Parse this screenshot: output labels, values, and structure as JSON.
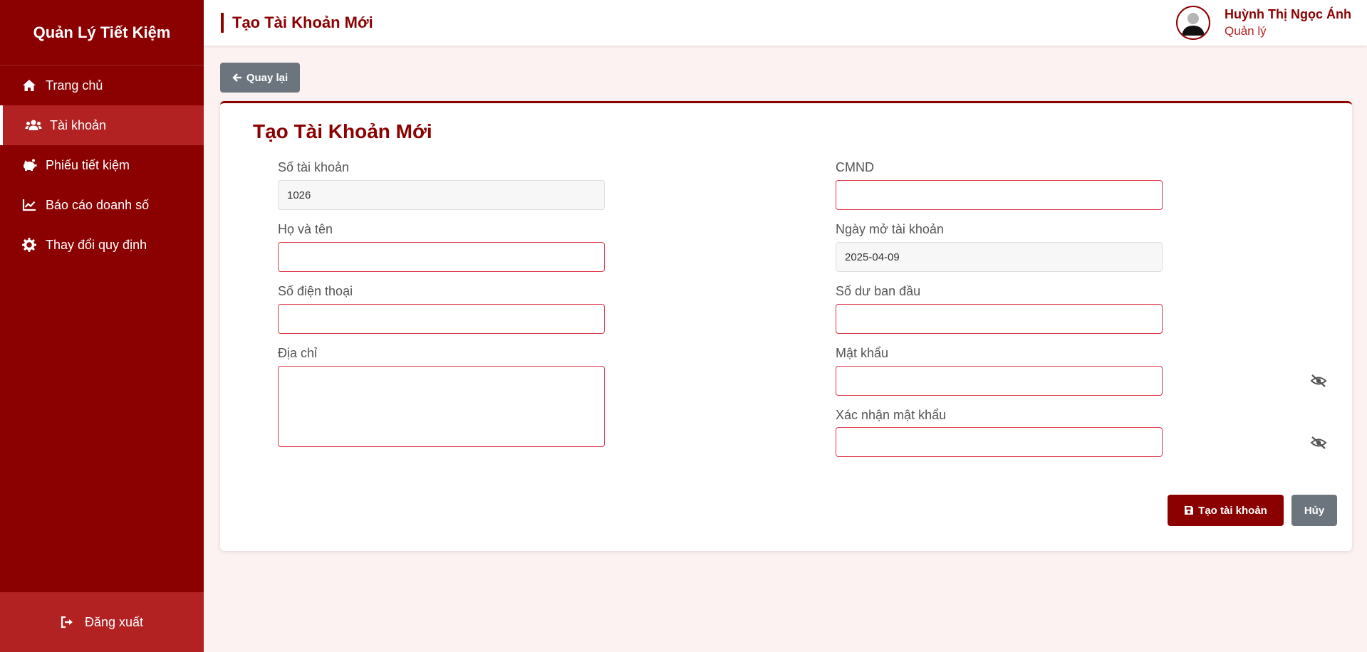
{
  "sidebar": {
    "brand": "Quản Lý Tiết Kiệm",
    "items": [
      {
        "label": "Trang chủ",
        "icon": "home-icon"
      },
      {
        "label": "Tài khoản",
        "icon": "users-icon",
        "active": true
      },
      {
        "label": "Phiếu tiết kiệm",
        "icon": "piggy-bank-icon"
      },
      {
        "label": "Báo cáo doanh số",
        "icon": "chart-line-icon"
      },
      {
        "label": "Thay đổi quy định",
        "icon": "gear-icon"
      }
    ],
    "logout_label": "Đăng xuất"
  },
  "header": {
    "title": "Tạo Tài Khoản Mới",
    "user_name": "Huỳnh Thị Ngọc Ánh",
    "user_role": "Quản lý"
  },
  "back_label": "Quay lại",
  "form": {
    "title": "Tạo Tài Khoản Mới",
    "account_number": {
      "label": "Số tài khoản",
      "value": "1026"
    },
    "full_name": {
      "label": "Họ và tên",
      "value": ""
    },
    "phone": {
      "label": "Số điện thoại",
      "value": ""
    },
    "address": {
      "label": "Địa chỉ",
      "value": ""
    },
    "id_card": {
      "label": "CMND",
      "value": ""
    },
    "open_date": {
      "label": "Ngày mở tài khoản",
      "value": "2025-04-09"
    },
    "initial_balance": {
      "label": "Số dư ban đầu",
      "value": ""
    },
    "password": {
      "label": "Mật khẩu",
      "value": ""
    },
    "confirm_password": {
      "label": "Xác nhận mật khẩu",
      "value": ""
    },
    "submit_label": "Tạo tài khoản",
    "cancel_label": "Hủy"
  },
  "colors": {
    "primary": "#8b0000",
    "primary_light": "#b22222",
    "secondary": "#6c757d",
    "input_border": "#dc3545",
    "background": "#fdf2f2"
  }
}
